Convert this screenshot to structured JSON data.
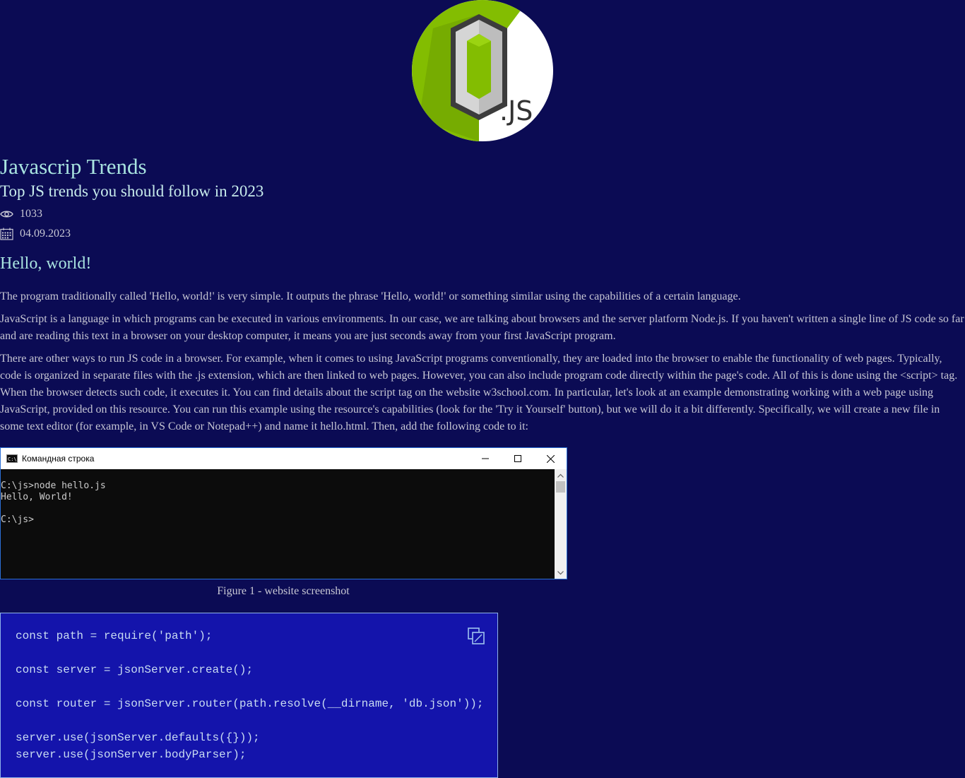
{
  "logo": {
    "text": ".JS"
  },
  "article": {
    "title": "Javascrip Trends",
    "subtitle": "Top JS trends you should follow in 2023",
    "views": "1033",
    "date": "04.09.2023",
    "section_heading": "Hello, world!",
    "paragraphs": [
      "The program traditionally called 'Hello, world!' is very simple. It outputs the phrase 'Hello, world!' or something similar using the capabilities of a certain language.",
      "JavaScript is a language in which programs can be executed in various environments. In our case, we are talking about browsers and the server platform Node.js. If you haven't written a single line of JS code so far and are reading this text in a browser on your desktop computer, it means you are just seconds away from your first JavaScript program.",
      "There are other ways to run JS code in a browser. For example, when it comes to using JavaScript programs conventionally, they are loaded into the browser to enable the functionality of web pages. Typically, code is organized in separate files with the .js extension, which are then linked to web pages. However, you can also include program code directly within the page's code. All of this is done using the <script> tag. When the browser detects such code, it executes it. You can find details about the script tag on the website w3school.com. In particular, let's look at an example demonstrating working with a web page using JavaScript, provided on this resource. You can run this example using the resource's capabilities (look for the 'Try it Yourself' button), but we will do it a bit differently. Specifically, we will create a new file in some text editor (for example, in VS Code or Notepad++) and name it hello.html. Then, add the following code to it:"
    ],
    "figure_caption": "Figure 1 - website screenshot"
  },
  "console": {
    "window_title": "Командная строка",
    "icon_text": "C:\\",
    "lines": [
      "C:\\js>node hello.js",
      "Hello, World!",
      "",
      "C:\\js>"
    ]
  },
  "code": {
    "lines": [
      "const path = require('path');",
      "",
      "const server = jsonServer.create();",
      "",
      "const router = jsonServer.router(path.resolve(__dirname, 'db.json'));",
      "",
      "server.use(jsonServer.defaults({}));",
      "server.use(jsonServer.bodyParser);"
    ]
  },
  "colors": {
    "background": "#0b0b54",
    "heading": "#a9e4e0",
    "code_bg": "#1414ab",
    "node_green": "#83bd01"
  }
}
